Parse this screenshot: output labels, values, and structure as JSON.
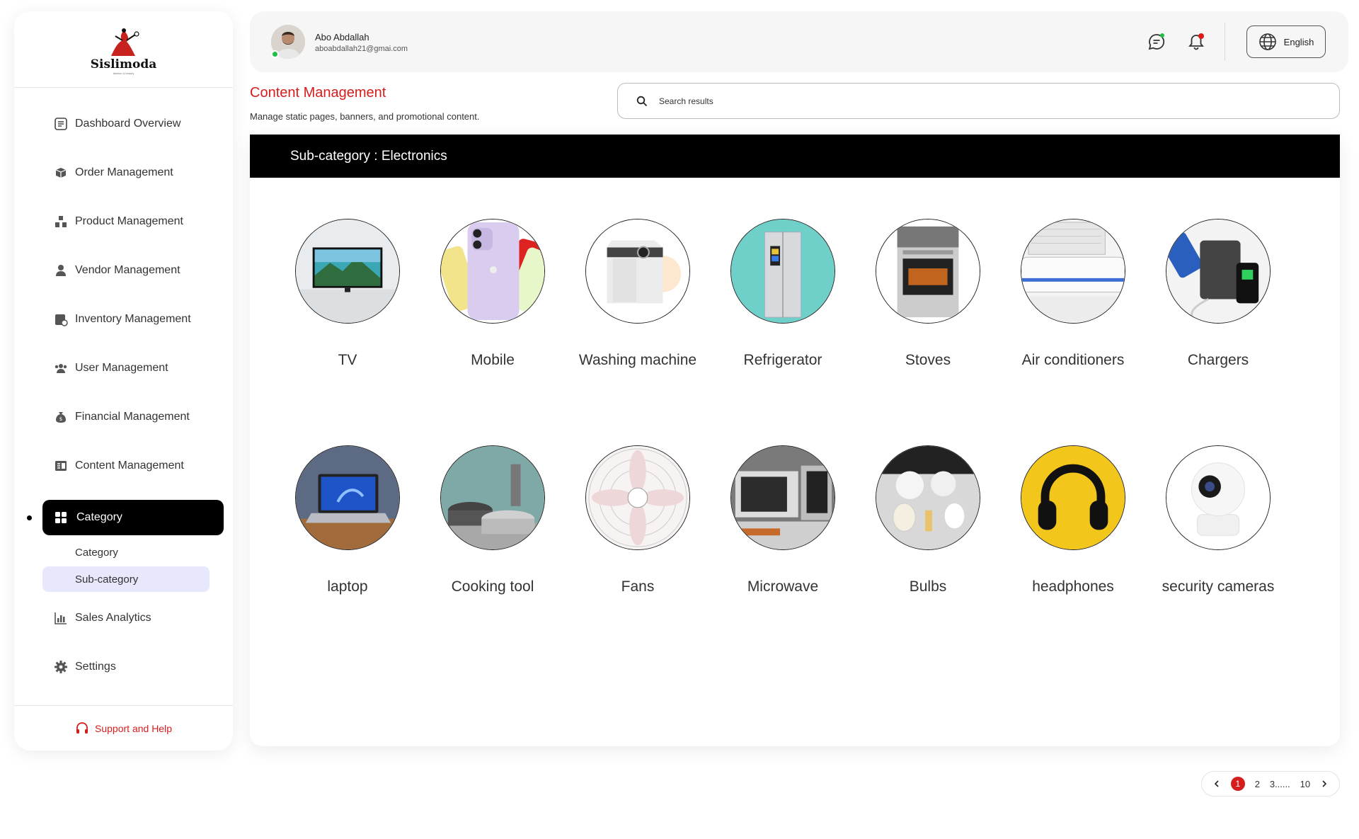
{
  "brand": {
    "name": "Sislimoda",
    "tagline": "fashion & beauty"
  },
  "sidebar": {
    "items": [
      {
        "label": "Dashboard Overview",
        "icon": "dashboard-icon"
      },
      {
        "label": "Order Management",
        "icon": "order-box-icon"
      },
      {
        "label": "Product Management",
        "icon": "product-boxes-icon"
      },
      {
        "label": "Vendor Management",
        "icon": "vendor-icon"
      },
      {
        "label": "Inventory Management",
        "icon": "inventory-icon"
      },
      {
        "label": "User Management",
        "icon": "users-icon"
      },
      {
        "label": "Financial Management",
        "icon": "money-bag-icon"
      },
      {
        "label": "Content Management",
        "icon": "content-icon"
      }
    ],
    "active": {
      "label": "Category",
      "icon": "grid-icon"
    },
    "sub_items": [
      {
        "label": "Category"
      },
      {
        "label": "Sub-category"
      }
    ],
    "bottom_items": [
      {
        "label": "Sales Analytics",
        "icon": "analytics-icon"
      },
      {
        "label": "Settings",
        "icon": "gear-icon"
      }
    ],
    "support_label": "Support and Help"
  },
  "header": {
    "user_name": "Abo Abdallah",
    "user_email": "aboabdallah21@gmai.com",
    "language": "English"
  },
  "page": {
    "title": "Content Management",
    "subtitle": "Manage static pages, banners, and promotional content.",
    "search_placeholder": "Search results"
  },
  "card": {
    "heading": "Sub-category : Electronics",
    "subcategories": [
      {
        "label": "TV"
      },
      {
        "label": "Mobile"
      },
      {
        "label": "Washing machine"
      },
      {
        "label": "Refrigerator"
      },
      {
        "label": "Stoves"
      },
      {
        "label": "Air conditioners"
      },
      {
        "label": "Chargers"
      },
      {
        "label": "laptop"
      },
      {
        "label": "Cooking tool"
      },
      {
        "label": "Fans"
      },
      {
        "label": "Microwave"
      },
      {
        "label": "Bulbs"
      },
      {
        "label": "headphones"
      },
      {
        "label": "security cameras"
      }
    ]
  },
  "pagination": {
    "current": "1",
    "pages": [
      "2",
      "3......",
      "10"
    ]
  },
  "colors": {
    "accent": "#d61d1d",
    "active_bg": "#000000",
    "selected_sub_bg": "#e7e8fb",
    "online": "#1fbf45"
  }
}
